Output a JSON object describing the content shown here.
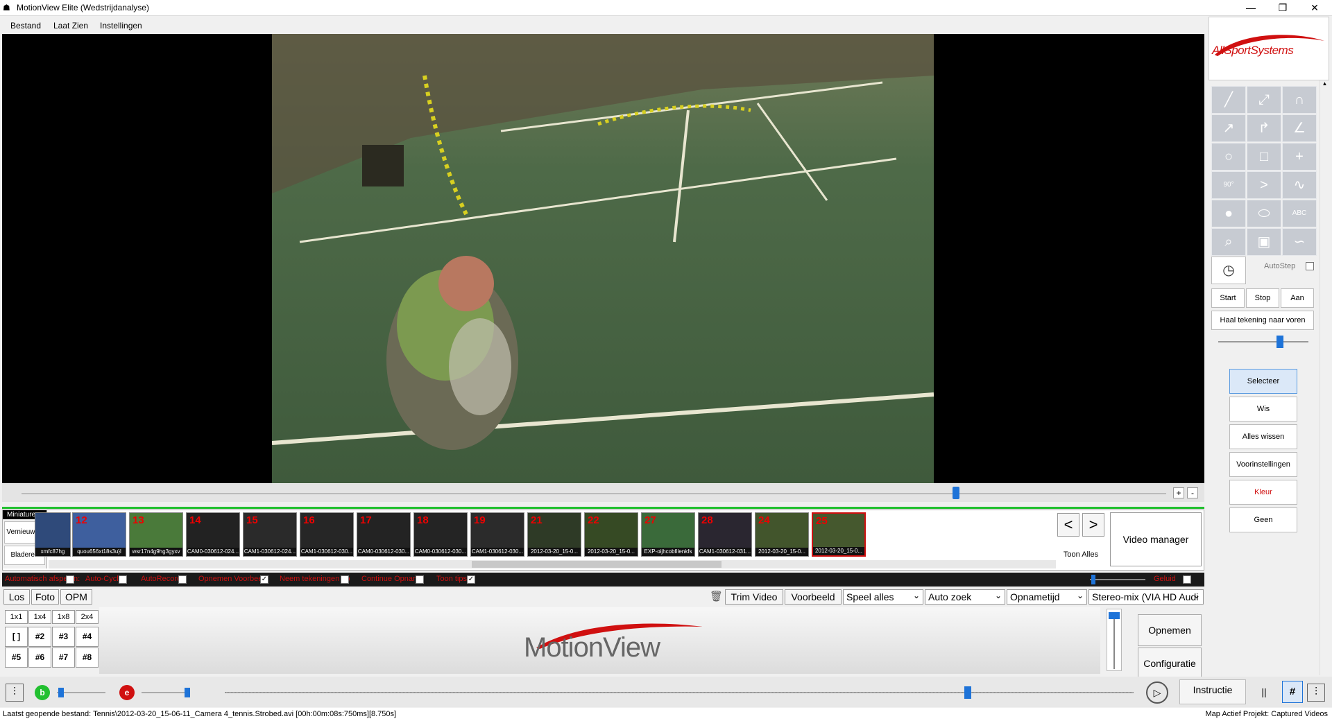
{
  "window": {
    "title": "MotionView Elite (Wedstrijdanalyse)",
    "minimize": "—",
    "restore": "❐",
    "close": "✕"
  },
  "menu": [
    "Bestand",
    "Laat Zien",
    "Instellingen"
  ],
  "brand": {
    "right_logo": "AllSportSystems",
    "main_logo": "MotionView",
    "accent": "#d01010"
  },
  "thumbnails": {
    "panel_label": "Miniaturen",
    "refresh": "Vernieuwen",
    "browse": "Bladeren",
    "items": [
      {
        "num": "",
        "caption": "xmfc87hg"
      },
      {
        "num": "12",
        "caption": "quou656xt18s3u}l"
      },
      {
        "num": "13",
        "caption": "wsr17n4g9hg3gyxv"
      },
      {
        "num": "14",
        "caption": "CAM0-030612-024..."
      },
      {
        "num": "15",
        "caption": "CAM1-030612-024..."
      },
      {
        "num": "16",
        "caption": "CAM1-030612-030..."
      },
      {
        "num": "17",
        "caption": "CAM0-030612-030..."
      },
      {
        "num": "18",
        "caption": "CAM0-030612-030..."
      },
      {
        "num": "19",
        "caption": "CAM1-030612-030..."
      },
      {
        "num": "21",
        "caption": "2012-03-20_15-0..."
      },
      {
        "num": "22",
        "caption": "2012-03-20_15-0..."
      },
      {
        "num": "27",
        "caption": "EXP-oijhcobfilenkfs"
      },
      {
        "num": "28",
        "caption": "CAM1-030612-031..."
      },
      {
        "num": "24",
        "caption": "2012-03-20_15-0..."
      },
      {
        "num": "25",
        "caption": "2012-03-20_15-0..."
      }
    ],
    "prev": "<",
    "next": ">",
    "show_all": "Toon Alles",
    "video_manager": "Video manager"
  },
  "scrub": {
    "plus": "+",
    "minus": "-"
  },
  "options": [
    {
      "label": "Automatisch afspelen:",
      "checked": false
    },
    {
      "label": "Auto-Cycle",
      "checked": false
    },
    {
      "label": "AutoRecord",
      "checked": false
    },
    {
      "label": "Opnemen Voorbeeld",
      "checked": true
    },
    {
      "label": "Neem tekeningen op",
      "checked": false
    },
    {
      "label": "Continue Opname",
      "checked": false
    },
    {
      "label": "Toon tips",
      "checked": true
    }
  ],
  "sound_label": "Geluid",
  "toolbar": {
    "los": "Los",
    "foto": "Foto",
    "opm": "OPM",
    "trim": "Trim Video",
    "preview": "Voorbeeld",
    "speel": "Speel alles",
    "autozoek": "Auto zoek",
    "opnametijd": "Opnametijd",
    "audio": "Stereo-mix (VIA HD Audi"
  },
  "layout_grid": [
    "1x1",
    "1x4",
    "1x8",
    "2x4",
    "[ ]",
    "#2",
    "#3",
    "#4",
    "#5",
    "#6",
    "#7",
    "#8"
  ],
  "record_buttons": {
    "record": "Opnemen",
    "config": "Configuratie"
  },
  "bottom": {
    "b_label": "b",
    "e_label": "e",
    "instructie": "Instructie",
    "pause": "||",
    "hash": "#"
  },
  "status": {
    "left": "Laatst geopende bestand: Tennis\\2012-03-20_15-06-11_Camera 4_tennis.Strobed.avi   [00h:00m:08s:750ms][8.750s]",
    "right": "Map Actief Projekt: Captured Videos"
  },
  "right_panel": {
    "autostep": "AutoStep",
    "start": "Start",
    "stop": "Stop",
    "aan": "Aan",
    "bring_front": "Haal tekening naar voren",
    "select": "Selecteer",
    "wis": "Wis",
    "alles_wissen": "Alles wissen",
    "presets": "Voorinstellingen",
    "kleur": "Kleur",
    "geen": "Geen",
    "tool_icons": [
      "line",
      "line-point",
      "arc",
      "arrow",
      "curved-arrow",
      "angle-line",
      "circle",
      "rectangle",
      "crosshair",
      "angle-90",
      "angle",
      "curve",
      "spot",
      "ellipse-filled",
      "text-abc",
      "magnifier",
      "screen",
      "path-star",
      "timer"
    ],
    "tool_text_abc": "ABC",
    "tool_text_90": "90°"
  }
}
